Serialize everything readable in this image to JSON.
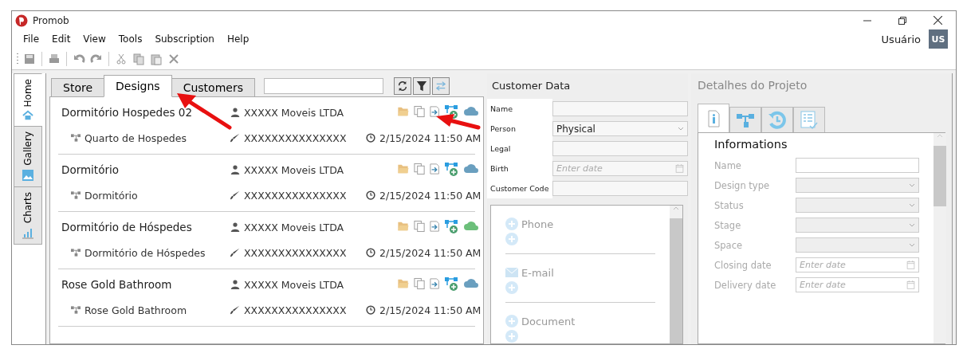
{
  "window": {
    "title": "Promob"
  },
  "menu": [
    "File",
    "Edit",
    "View",
    "Tools",
    "Subscription",
    "Help"
  ],
  "user": {
    "name": "Usuário",
    "initials": "US"
  },
  "side_tabs": [
    {
      "label": "Home",
      "selected": true
    },
    {
      "label": "Gallery",
      "selected": false
    },
    {
      "label": "Charts",
      "selected": false
    }
  ],
  "design_tabs": [
    {
      "label": "Store",
      "selected": false
    },
    {
      "label": "Designs",
      "selected": true
    },
    {
      "label": "Customers",
      "selected": false
    }
  ],
  "designs": [
    {
      "name": "Dormitório Hospedes 02",
      "customer": "XXXXX Moveis LTDA",
      "environment": "Quarto de Hospedes",
      "designer": "XXXXXXXXXXXXXXX",
      "date": "2/15/2024 11:50 AM",
      "color": "#6a9fbf"
    },
    {
      "name": "Dormitório",
      "customer": "XXXXX Moveis LTDA",
      "environment": "Dormitório",
      "designer": "XXXXXXXXXXXXXXX",
      "date": "2/15/2024 11:50 AM",
      "color": "#6a9fbf"
    },
    {
      "name": "Dormitório de Hóspedes",
      "customer": "XXXXX Moveis LTDA",
      "environment": "Dormitório de Hóspedes",
      "designer": "XXXXXXXXXXXXXXX",
      "date": "2/15/2024 11:50 AM",
      "color": "#6cbf7a"
    },
    {
      "name": "Rose Gold Bathroom",
      "customer": "XXXXX Moveis LTDA",
      "environment": "Rose Gold Bathroom",
      "designer": "XXXXXXXXXXXXXXX",
      "date": "2/15/2024 11:50 AM",
      "color": "#6a9fbf"
    }
  ],
  "customer_data": {
    "title": "Customer Data",
    "fields": [
      {
        "label": "Name",
        "kind": "text"
      },
      {
        "label": "Person",
        "kind": "select",
        "value": "Physical"
      },
      {
        "label": "Legal",
        "kind": "text"
      },
      {
        "label": "Birth",
        "kind": "date",
        "placeholder": "Enter date"
      },
      {
        "label": "Customer Code",
        "kind": "text"
      }
    ],
    "contacts": [
      "Phone",
      "E-mail",
      "Document"
    ]
  },
  "project_details": {
    "title": "Detalhes do Projeto",
    "tabs": [
      {
        "selected": true
      },
      {
        "selected": false
      },
      {
        "selected": false
      },
      {
        "selected": false
      }
    ],
    "section": "Informations",
    "fields": [
      {
        "label": "Name",
        "kind": "text"
      },
      {
        "label": "Design type",
        "kind": "select"
      },
      {
        "label": "Status",
        "kind": "select"
      },
      {
        "label": "Stage",
        "kind": "select"
      },
      {
        "label": "Space",
        "kind": "select"
      },
      {
        "label": "Closing date",
        "kind": "date",
        "placeholder": "Enter date"
      },
      {
        "label": "Delivery date",
        "kind": "date",
        "placeholder": "Enter date"
      }
    ]
  }
}
